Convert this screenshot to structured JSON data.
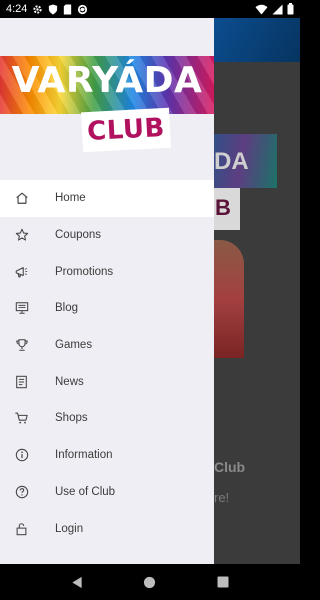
{
  "status_bar": {
    "time": "4:24"
  },
  "drawer": {
    "logo_main": "VARYÁDA",
    "logo_club": "CLUB",
    "items": [
      {
        "label": "Home",
        "icon": "home-icon",
        "active": true
      },
      {
        "label": "Coupons",
        "icon": "star-icon"
      },
      {
        "label": "Promotions",
        "icon": "megaphone-icon"
      },
      {
        "label": "Blog",
        "icon": "monitor-icon"
      },
      {
        "label": "Games",
        "icon": "trophy-icon"
      },
      {
        "label": "News",
        "icon": "document-icon"
      },
      {
        "label": "Shops",
        "icon": "cart-icon"
      },
      {
        "label": "Information",
        "icon": "info-icon"
      },
      {
        "label": "Use of Club",
        "icon": "help-icon"
      },
      {
        "label": "Login",
        "icon": "lock-icon"
      }
    ]
  },
  "background": {
    "logo_text": "DA",
    "club_text": "B",
    "title_fragment": "Club",
    "text_fragment": "re!"
  },
  "colors": {
    "drawer_bg": "#efeef4",
    "active_item_bg": "#ffffff",
    "club_magenta": "#b0125f"
  }
}
